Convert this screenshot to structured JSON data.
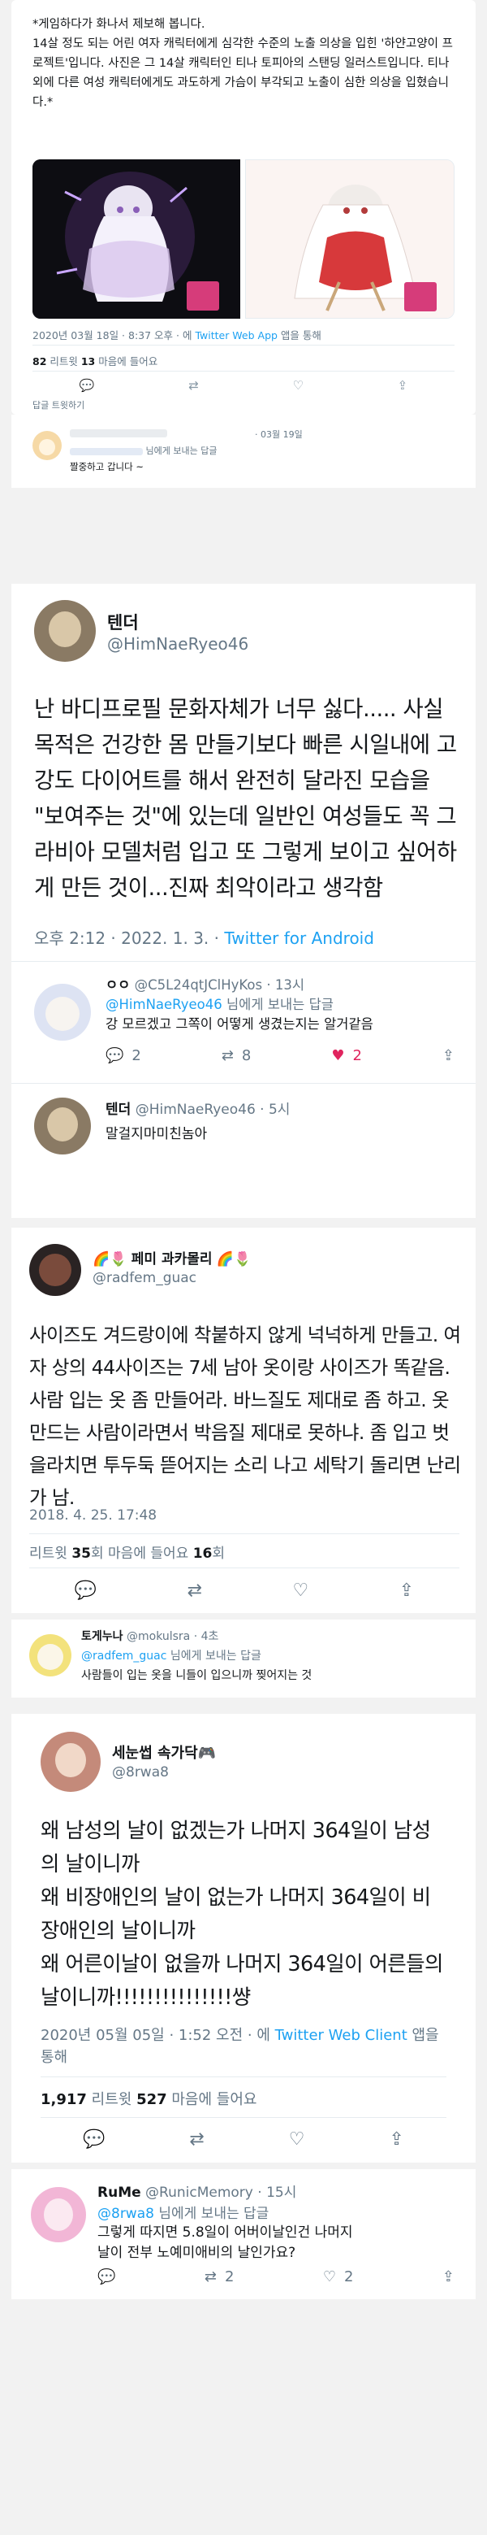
{
  "tweet1": {
    "body": "*게임하다가 화나서 제보해 봅니다.\n14살 정도 되는 어린 여자 캐릭터에게 심각한 수준의 노출 의상을 입힌 '하얀고양이 프로젝트'입니다. 사진은 그 14살 캐릭터인 티나 토피아의 스탠딩 일러스트입니다. 티나 외에 다른 여성 캐릭터에게도 과도하게 가슴이 부각되고 노출이 심한 의상을 입혔습니다.*",
    "meta": "2020년 03월 18일 · 8:37 오후 · 에 ",
    "client": "Twitter Web App",
    "meta_suffix": " 앱을 통해",
    "retweets": "82",
    "retweets_label": " 리트윗  ",
    "likes": "13",
    "likes_label": " 마음에 들어요",
    "thread_link": "답글 트윗하기",
    "reply_date": "· 03월 19일",
    "reply_to": "님에게 보내는 답글",
    "reply_text": "짤중하고 갑니다 ~"
  },
  "tweet2": {
    "name": "텐더",
    "handle": "@HimNaeRyeo46",
    "body": "난 바디프로필 문화자체가 너무 싫다..... 사실 목적은 건강한 몸 만들기보다 빠른 시일내에 고강도 다이어트를 해서 완전히 달라진 모습을 \"보여주는 것\"에 있는데 일반인 여성들도 꼭 그라비아 모델처럼 입고 또 그렇게 보이고 싶어하게 만든 것이...진짜 최악이라고 생각함",
    "time": "오후 2:12 · 2022. 1. 3. · ",
    "client": "Twitter for Android",
    "reply1": {
      "name": "ㅇㅇ",
      "handle": "@C5L24qtJClHyKos · 13시",
      "to": "@HimNaeRyeo46",
      "to_suffix": " 님에게 보내는 답글",
      "text": "강 모르겠고 그쪽이 어떻게 생겼는지는 알거같음",
      "replies": "2",
      "retweets": "8",
      "likes": "2"
    },
    "reply2": {
      "name": "텐더",
      "handle": "@HimNaeRyeo46 · 5시",
      "text": "말걸지마미친놈아"
    }
  },
  "tweet3": {
    "name": "페미 과카몰리",
    "handle": "@radfem_guac",
    "body": "사이즈도 겨드랑이에 착붙하지 않게 넉넉하게 만들고. 여자 상의 44사이즈는 7세 남아 옷이랑 사이즈가 똑같음.\n사람 입는 옷 좀 만들어라. 바느질도 제대로 좀 하고. 옷 만드는 사람이라면서 박음질 제대로 못하냐. 좀 입고 벗을라치면 투두둑 뜯어지는 소리 나고 세탁기 돌리면 난리가 남.",
    "time": "2018. 4. 25. 17:48",
    "retweets_label": "리트윗 ",
    "retweets": "35",
    "retweets_unit": "회",
    "likes_label": "  마음에 들어요 ",
    "likes": "16",
    "likes_unit": "회",
    "reply": {
      "name": "토게누나",
      "handle": "@mokulsra · 4초",
      "to": "@radfem_guac",
      "to_suffix": " 님에게 보내는 답글",
      "text": "사람들이 입는 옷을 니들이 입으니까 찢어지는 것"
    }
  },
  "tweet4": {
    "name": "세눈썹 속가닥🎮",
    "handle": "@8rwa8",
    "body": "왜 남성의 날이 없겠는가 나머지 364일이 남성의 날이니까\n왜 비장애인의 날이 없는가 나머지 364일이 비장애인의 날이니까\n왜 어른이날이 없을까 나머지 364일이 어른들의 날이니까!!!!!!!!!!!!!!!썅",
    "time": "2020년 05월 05일 · 1:52 오전 · 에 ",
    "client": "Twitter Web Client",
    "client_suffix": " 앱을 통해",
    "retweets": "1,917",
    "retweets_label": " 리트윗   ",
    "likes": "527",
    "likes_label": " 마음에 들어요",
    "reply": {
      "name": "RuMe",
      "handle": "@RunicMemory · 15시",
      "to": "@8rwa8",
      "to_suffix": " 님에게 보내는 답글",
      "text": "그렇게 따지면 5.8일이 어버이날인건 나머지날이 전부 노예미애비의 날인가요?",
      "retweets": "2",
      "likes": "2"
    }
  },
  "colors": {
    "accent": "#1da1f2",
    "like_active": "#e0245e",
    "text": "#14171a",
    "muted": "#657786"
  }
}
